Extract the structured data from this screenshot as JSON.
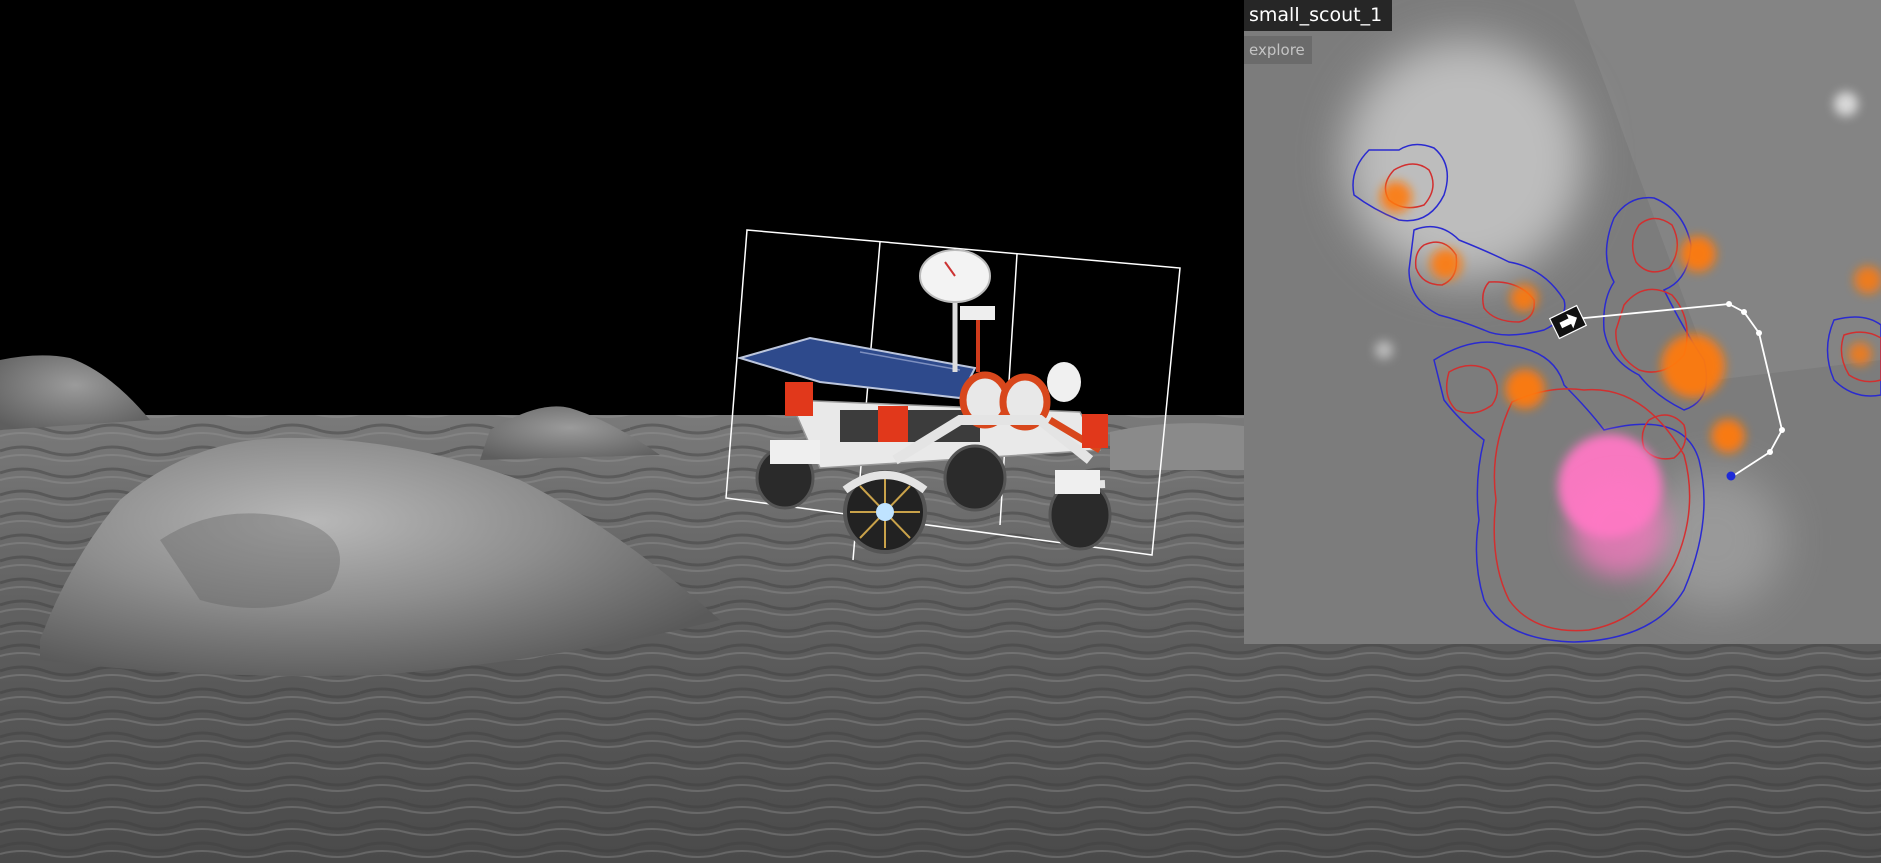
{
  "minimap": {
    "robot_name": "small_scout_1",
    "mode": "explore"
  },
  "icons": {
    "rover": "rover-icon",
    "robot_marker": "robot-arrow-icon",
    "goal_marker": "goal-dot-icon"
  },
  "colors": {
    "sky": "#000000",
    "terrain": "#6e6e6e",
    "map_background": "#7c7c7c",
    "resource_orange": "#ff7a10",
    "resource_pink": "#ff78c4",
    "contour_red": "#d22f2f",
    "contour_blue": "#2a2ad0",
    "path_white": "#ffffff"
  }
}
